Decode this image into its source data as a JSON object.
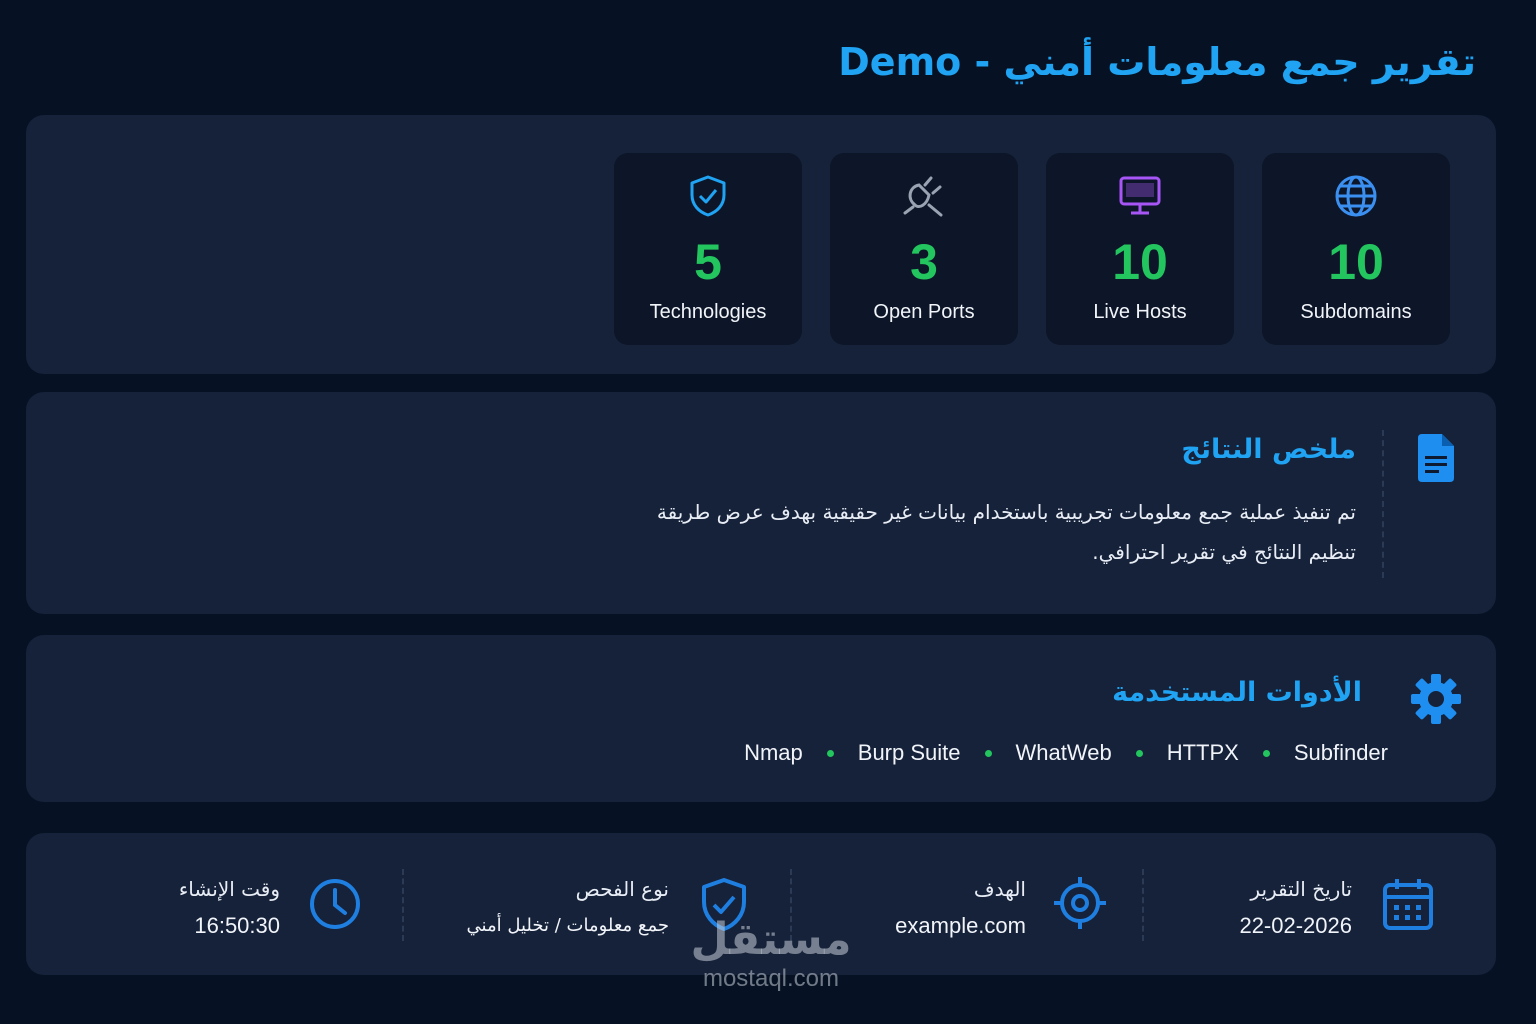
{
  "page": {
    "title": "تقرير جمع معلومات أمني - Demo"
  },
  "stats": [
    {
      "icon": "shield-check-icon",
      "value": "5",
      "label": "Technologies",
      "color": "#1fa3f2"
    },
    {
      "icon": "plug-icon",
      "value": "3",
      "label": "Open Ports",
      "color": "#9aa3b2"
    },
    {
      "icon": "monitor-icon",
      "value": "10",
      "label": "Live Hosts",
      "color": "#a855f7"
    },
    {
      "icon": "globe-icon",
      "value": "10",
      "label": "Subdomains",
      "color": "#3b8ff0"
    }
  ],
  "summary": {
    "title": "ملخص النتائج",
    "icon": "document-icon",
    "text": "تم تنفيذ عملية جمع معلومات تجريبية باستخدام بيانات غير حقيقية بهدف عرض طريقة تنظيم النتائج في تقرير احترافي."
  },
  "tools": {
    "title": "الأدوات المستخدمة",
    "icon": "gear-icon",
    "items": [
      "Nmap",
      "Burp Suite",
      "WhatWeb",
      "HTTPX",
      "Subfinder"
    ]
  },
  "meta": {
    "date_label": "تاريخ التقرير",
    "date_value": "22-02-2026",
    "target_label": "الهدف",
    "target_value": "example.com",
    "scan_label": "نوع الفحص",
    "scan_value": "جمع معلومات / تخليل أمني",
    "time_label": "وقت الإنشاء",
    "time_value": "16:50:30"
  },
  "watermark": {
    "arabic": "مستقل",
    "latin": "mostaql.com"
  },
  "colors": {
    "accent": "#1fa3f2",
    "number": "#22c55e",
    "panel": "#16223a",
    "background": "#061224"
  }
}
